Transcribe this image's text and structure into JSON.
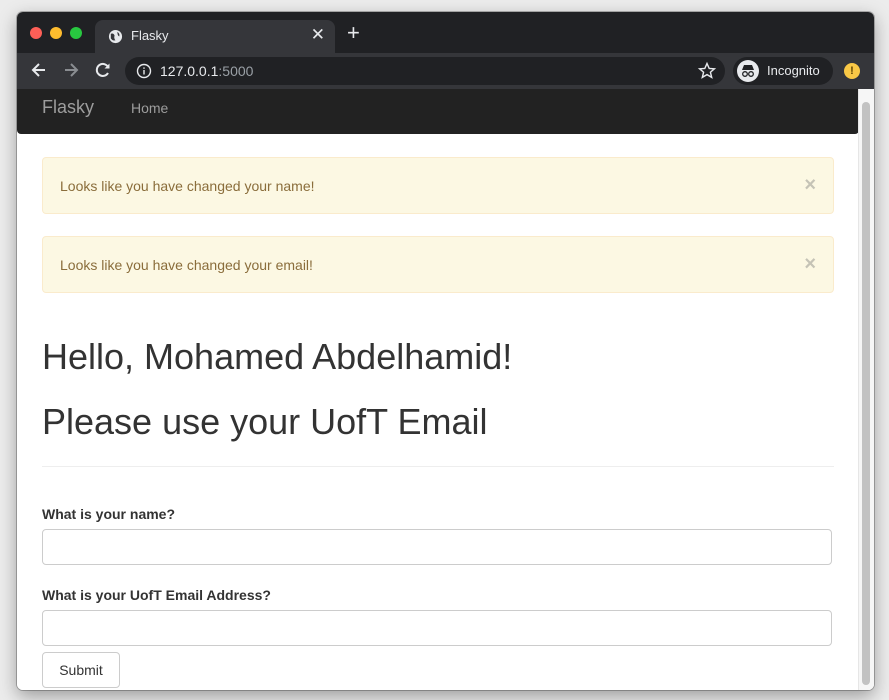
{
  "browser": {
    "tab_title": "Flasky",
    "url_host": "127.0.0.1",
    "url_port": ":5000",
    "incognito_label": "Incognito",
    "ext_badge": "!"
  },
  "navbar": {
    "brand": "Flasky",
    "home": "Home"
  },
  "alerts": [
    {
      "text": "Looks like you have changed your name!",
      "close": "×"
    },
    {
      "text": "Looks like you have changed your email!",
      "close": "×"
    }
  ],
  "main": {
    "greeting": "Hello, Mohamed Abdelhamid!",
    "notice": "Please use your UofT Email"
  },
  "form": {
    "name_label": "What is your name?",
    "name_value": "",
    "email_label": "What is your UofT Email Address?",
    "email_value": "",
    "submit_label": "Submit"
  },
  "colors": {
    "alert_bg": "#fcf8e3",
    "alert_text": "#8a6d3b",
    "navbar_bg": "#222222"
  }
}
